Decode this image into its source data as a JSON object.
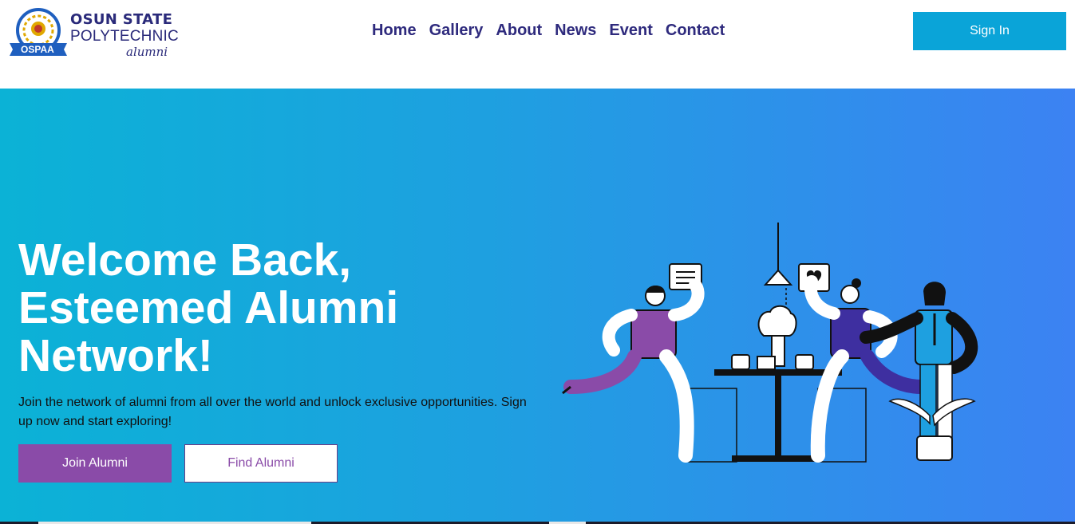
{
  "brand": {
    "line1": "OSUN STATE",
    "line2": "POLYTECHNIC",
    "line3": "alumni",
    "badge": "OSPAA",
    "colors": {
      "navy": "#2a2a7a",
      "blue": "#1f5fbf",
      "gold": "#e0a800"
    }
  },
  "nav": {
    "items": [
      {
        "label": "Home"
      },
      {
        "label": "Gallery"
      },
      {
        "label": "About"
      },
      {
        "label": "News"
      },
      {
        "label": "Event"
      },
      {
        "label": "Contact"
      }
    ]
  },
  "header": {
    "signin_label": "Sign In"
  },
  "hero": {
    "title": "Welcome Back, Esteemed Alumni Network!",
    "subtitle": "Join the network of alumni from all over the world and unlock exclusive opportunities. Sign up now and start exploring!",
    "join_label": "Join Alumni",
    "find_label": "Find Alumni",
    "illustration_icon": "people-networking-illustration"
  },
  "colors": {
    "nav_text": "#2e2a7d",
    "signin_bg": "#0aa4d8",
    "join_bg": "#8a4ba8",
    "hero_gradient_start": "#0bb2d6",
    "hero_gradient_end": "#3c82f3"
  }
}
